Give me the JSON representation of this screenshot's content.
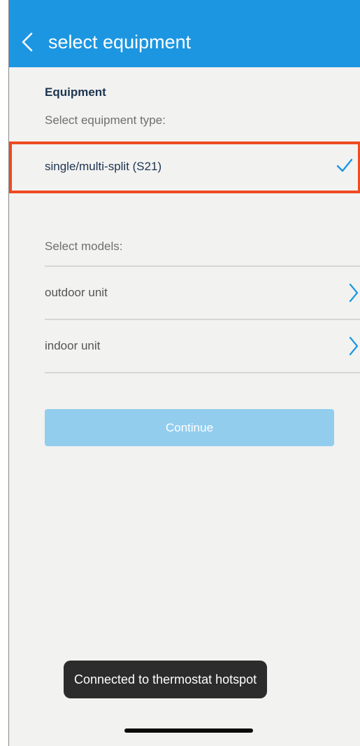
{
  "header": {
    "title": "select equipment",
    "back_icon": "chevron-left-icon"
  },
  "equipment": {
    "section_title": "Equipment",
    "type_hint": "Select equipment type:",
    "selected_type": "single/multi-split (S21)",
    "selected_icon": "checkmark-icon"
  },
  "models": {
    "hint": "Select models:",
    "items": [
      {
        "label": "outdoor unit",
        "icon": "chevron-right-icon"
      },
      {
        "label": "indoor unit",
        "icon": "chevron-right-icon"
      }
    ]
  },
  "actions": {
    "continue_label": "Continue",
    "continue_enabled": false
  },
  "toast": {
    "message": "Connected to thermostat hotspot"
  },
  "colors": {
    "header_bg": "#1c96e1",
    "accent": "#1c96e1",
    "highlight_border": "#ee4b21",
    "disabled_button": "#92cdee",
    "background": "#f2f2f1"
  }
}
